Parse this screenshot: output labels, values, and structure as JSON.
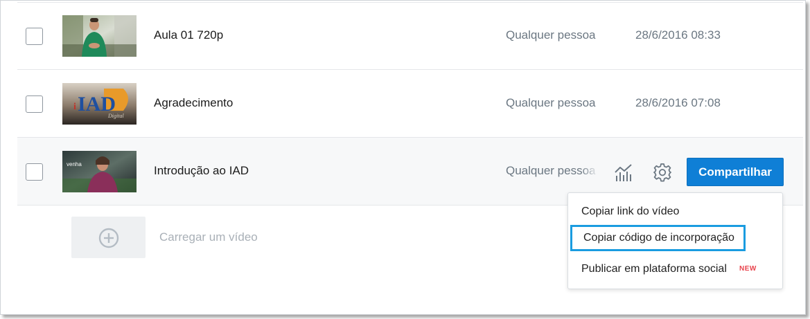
{
  "videos": [
    {
      "title": "Aula 01 720p",
      "privacy": "Qualquer pessoa",
      "date": "28/6/2016 08:33",
      "thumbnail": "person-outdoors"
    },
    {
      "title": "Agradecimento",
      "privacy": "Qualquer pessoa",
      "date": "28/6/2016 07:08",
      "thumbnail": "iad-logo"
    },
    {
      "title": "Introdução ao IAD",
      "privacy": "Qualquer pessoa",
      "date": "",
      "thumbnail": "person-venha"
    }
  ],
  "thumb_texts": {
    "iad_logo": "IAD",
    "iad_script": "Digital",
    "venha": "venha"
  },
  "hover_row": {
    "stats_icon": "bar-chart-icon",
    "settings_icon": "gear-icon",
    "share_label": "Compartilhar"
  },
  "upload": {
    "label": "Carregar um vídeo",
    "icon": "plus-circle-icon"
  },
  "share_menu": {
    "items": [
      {
        "label": "Copiar link do vídeo"
      },
      {
        "label": "Copiar código de incorporação",
        "highlighted": true
      },
      {
        "label": "Publicar em plataforma social",
        "badge": "NEW"
      }
    ]
  },
  "colors": {
    "accent": "#0f7fd6",
    "highlight_border": "#1a9ce0",
    "badge_new": "#e8424b",
    "muted_text": "#6b7782"
  }
}
